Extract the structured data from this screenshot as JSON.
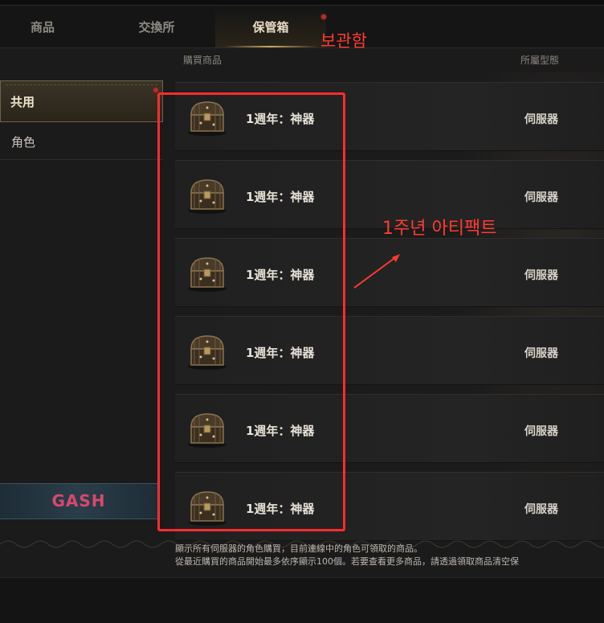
{
  "tabs": [
    {
      "label": "商品"
    },
    {
      "label": "交換所"
    },
    {
      "label": "保管箱"
    }
  ],
  "annotations": {
    "tab_note": "보관함",
    "list_note": "1주년 아티팩트"
  },
  "columns": {
    "item": "購買商品",
    "type": "所屬型態"
  },
  "sidebar": {
    "items": [
      {
        "label": "共用"
      },
      {
        "label": "角色"
      }
    ],
    "gash_label": "GASH"
  },
  "items": [
    {
      "name": "1週年：神器",
      "type": "伺服器"
    },
    {
      "name": "1週年：神器",
      "type": "伺服器"
    },
    {
      "name": "1週年：神器",
      "type": "伺服器"
    },
    {
      "name": "1週年：神器",
      "type": "伺服器"
    },
    {
      "name": "1週年：神器",
      "type": "伺服器"
    },
    {
      "name": "1週年：神器",
      "type": "伺服器"
    }
  ],
  "footer": {
    "line1": "顯示所有伺服器的角色購買，目前連線中的角色可領取的商品。",
    "line2": "從最近購買的商品開始最多依序顯示100個。若要查看更多商品，請透過領取商品清空保"
  },
  "colors": {
    "highlight": "#ff2d2d",
    "gash": "#d8486e",
    "accent_gold": "#c9a86a"
  }
}
